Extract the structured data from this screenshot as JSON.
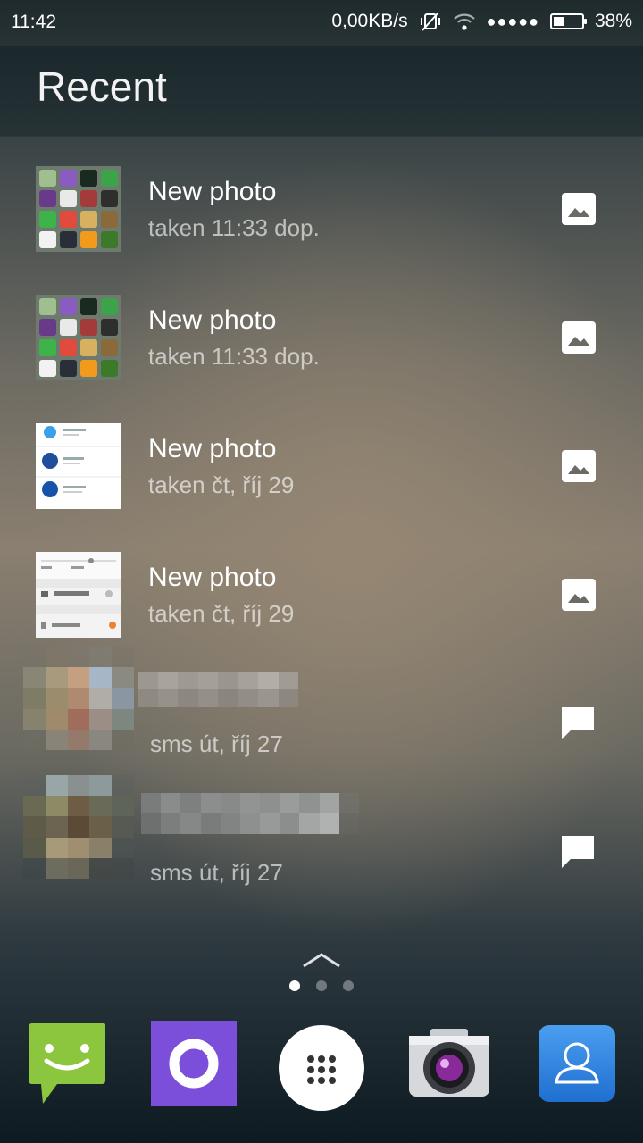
{
  "status_bar": {
    "time": "11:42",
    "network_speed": "0,00KB/s",
    "signal_dots": "●●●●●",
    "battery_percent": "38%",
    "battery_level": 0.38
  },
  "header": {
    "title": "Recent"
  },
  "recent_items": [
    {
      "title": "New photo",
      "subtitle": "taken 11:33 dop.",
      "kind": "photo",
      "type_icon": "image-icon"
    },
    {
      "title": "New photo",
      "subtitle": "taken 11:33 dop.",
      "kind": "photo",
      "type_icon": "image-icon"
    },
    {
      "title": "New photo",
      "subtitle": "taken čt, říj 29",
      "kind": "photo",
      "type_icon": "image-icon"
    },
    {
      "title": "New photo",
      "subtitle": "taken čt, říj 29",
      "kind": "photo",
      "type_icon": "image-icon"
    },
    {
      "subtitle": "sms út, říj 27",
      "kind": "sms",
      "type_icon": "message-icon"
    },
    {
      "subtitle": "sms út, říj 27",
      "kind": "sms",
      "type_icon": "message-icon"
    }
  ],
  "pager": {
    "pages": 3,
    "current": 1
  },
  "dock": [
    {
      "name": "messaging-app",
      "icon": "sms-icon"
    },
    {
      "name": "browser-app",
      "icon": "purple-ring-icon"
    },
    {
      "name": "app-drawer",
      "icon": "grid-dots-icon"
    },
    {
      "name": "camera-app",
      "icon": "camera-icon"
    },
    {
      "name": "contacts-app",
      "icon": "contact-icon"
    }
  ],
  "colors": {
    "accent_green": "#8cc63f",
    "purple": "#7b4fd9",
    "contacts_blue": "#2a7fd8"
  }
}
